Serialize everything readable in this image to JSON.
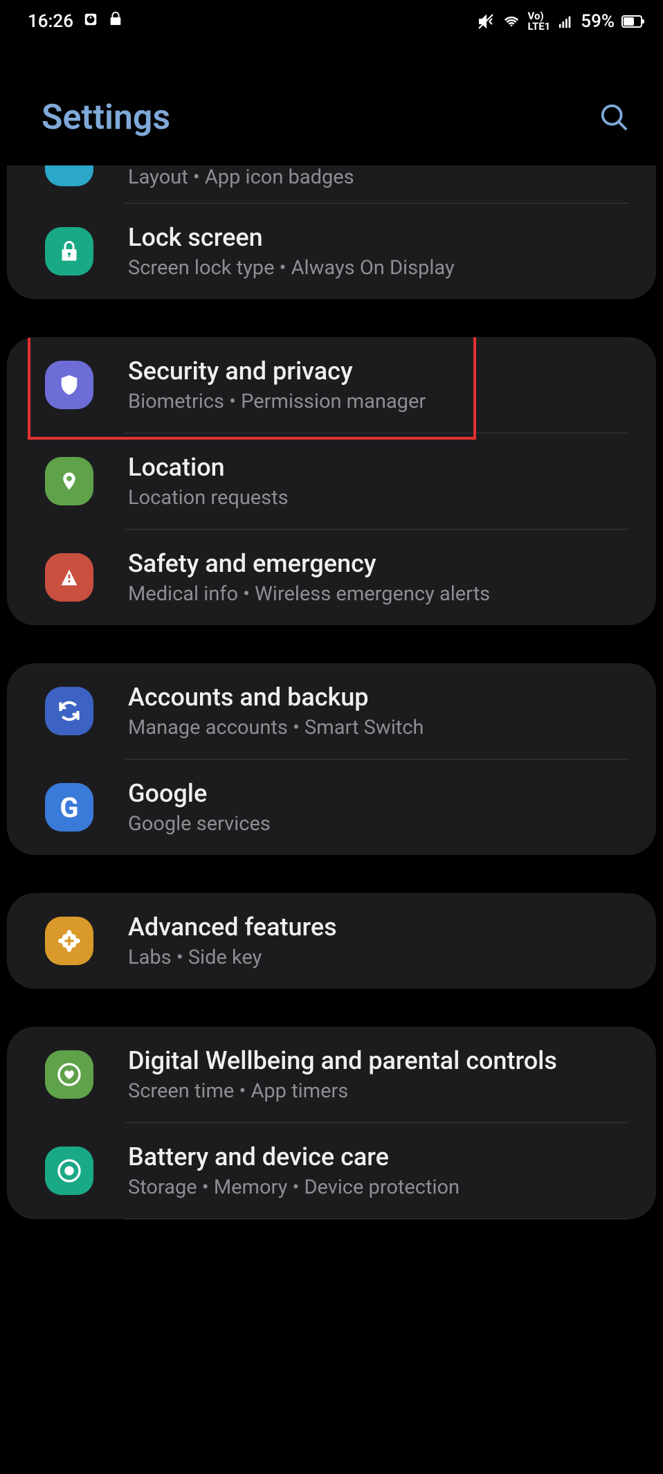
{
  "status": {
    "time": "16:26",
    "battery_pct": "59%"
  },
  "header": {
    "title": "Settings"
  },
  "groups": [
    {
      "partial": true,
      "items": [
        {
          "id": "home",
          "title": "",
          "sub": "Layout  •  App icon badges",
          "color": "#2aa7c9",
          "icon": "home",
          "partial": true
        },
        {
          "id": "lock-screen",
          "title": "Lock screen",
          "sub": "Screen lock type  •  Always On Display",
          "color": "#1aa986",
          "icon": "lock"
        }
      ]
    },
    {
      "items": [
        {
          "id": "security-privacy",
          "title": "Security and privacy",
          "sub": "Biometrics  •  Permission manager",
          "color": "#6d6dd8",
          "icon": "shield",
          "highlight": true
        },
        {
          "id": "location",
          "title": "Location",
          "sub": "Location requests",
          "color": "#5fa24a",
          "icon": "pin"
        },
        {
          "id": "safety",
          "title": "Safety and emergency",
          "sub": "Medical info  •  Wireless emergency alerts",
          "color": "#c9503f",
          "icon": "alert"
        }
      ]
    },
    {
      "items": [
        {
          "id": "accounts",
          "title": "Accounts and backup",
          "sub": "Manage accounts  •  Smart Switch",
          "color": "#3c63c4",
          "icon": "sync"
        },
        {
          "id": "google",
          "title": "Google",
          "sub": "Google services",
          "color": "#3a7ad9",
          "icon": "g"
        }
      ]
    },
    {
      "items": [
        {
          "id": "advanced",
          "title": "Advanced features",
          "sub": "Labs  •  Side key",
          "color": "#d99a2b",
          "icon": "plus-gear"
        }
      ]
    },
    {
      "items": [
        {
          "id": "wellbeing",
          "title": "Digital Wellbeing and parental controls",
          "sub": "Screen time  •  App timers",
          "color": "#5fa24a",
          "icon": "heart-circle"
        },
        {
          "id": "battery",
          "title": "Battery and device care",
          "sub": "Storage  •  Memory  •  Device protection",
          "color": "#1aa986",
          "icon": "target"
        }
      ]
    }
  ]
}
